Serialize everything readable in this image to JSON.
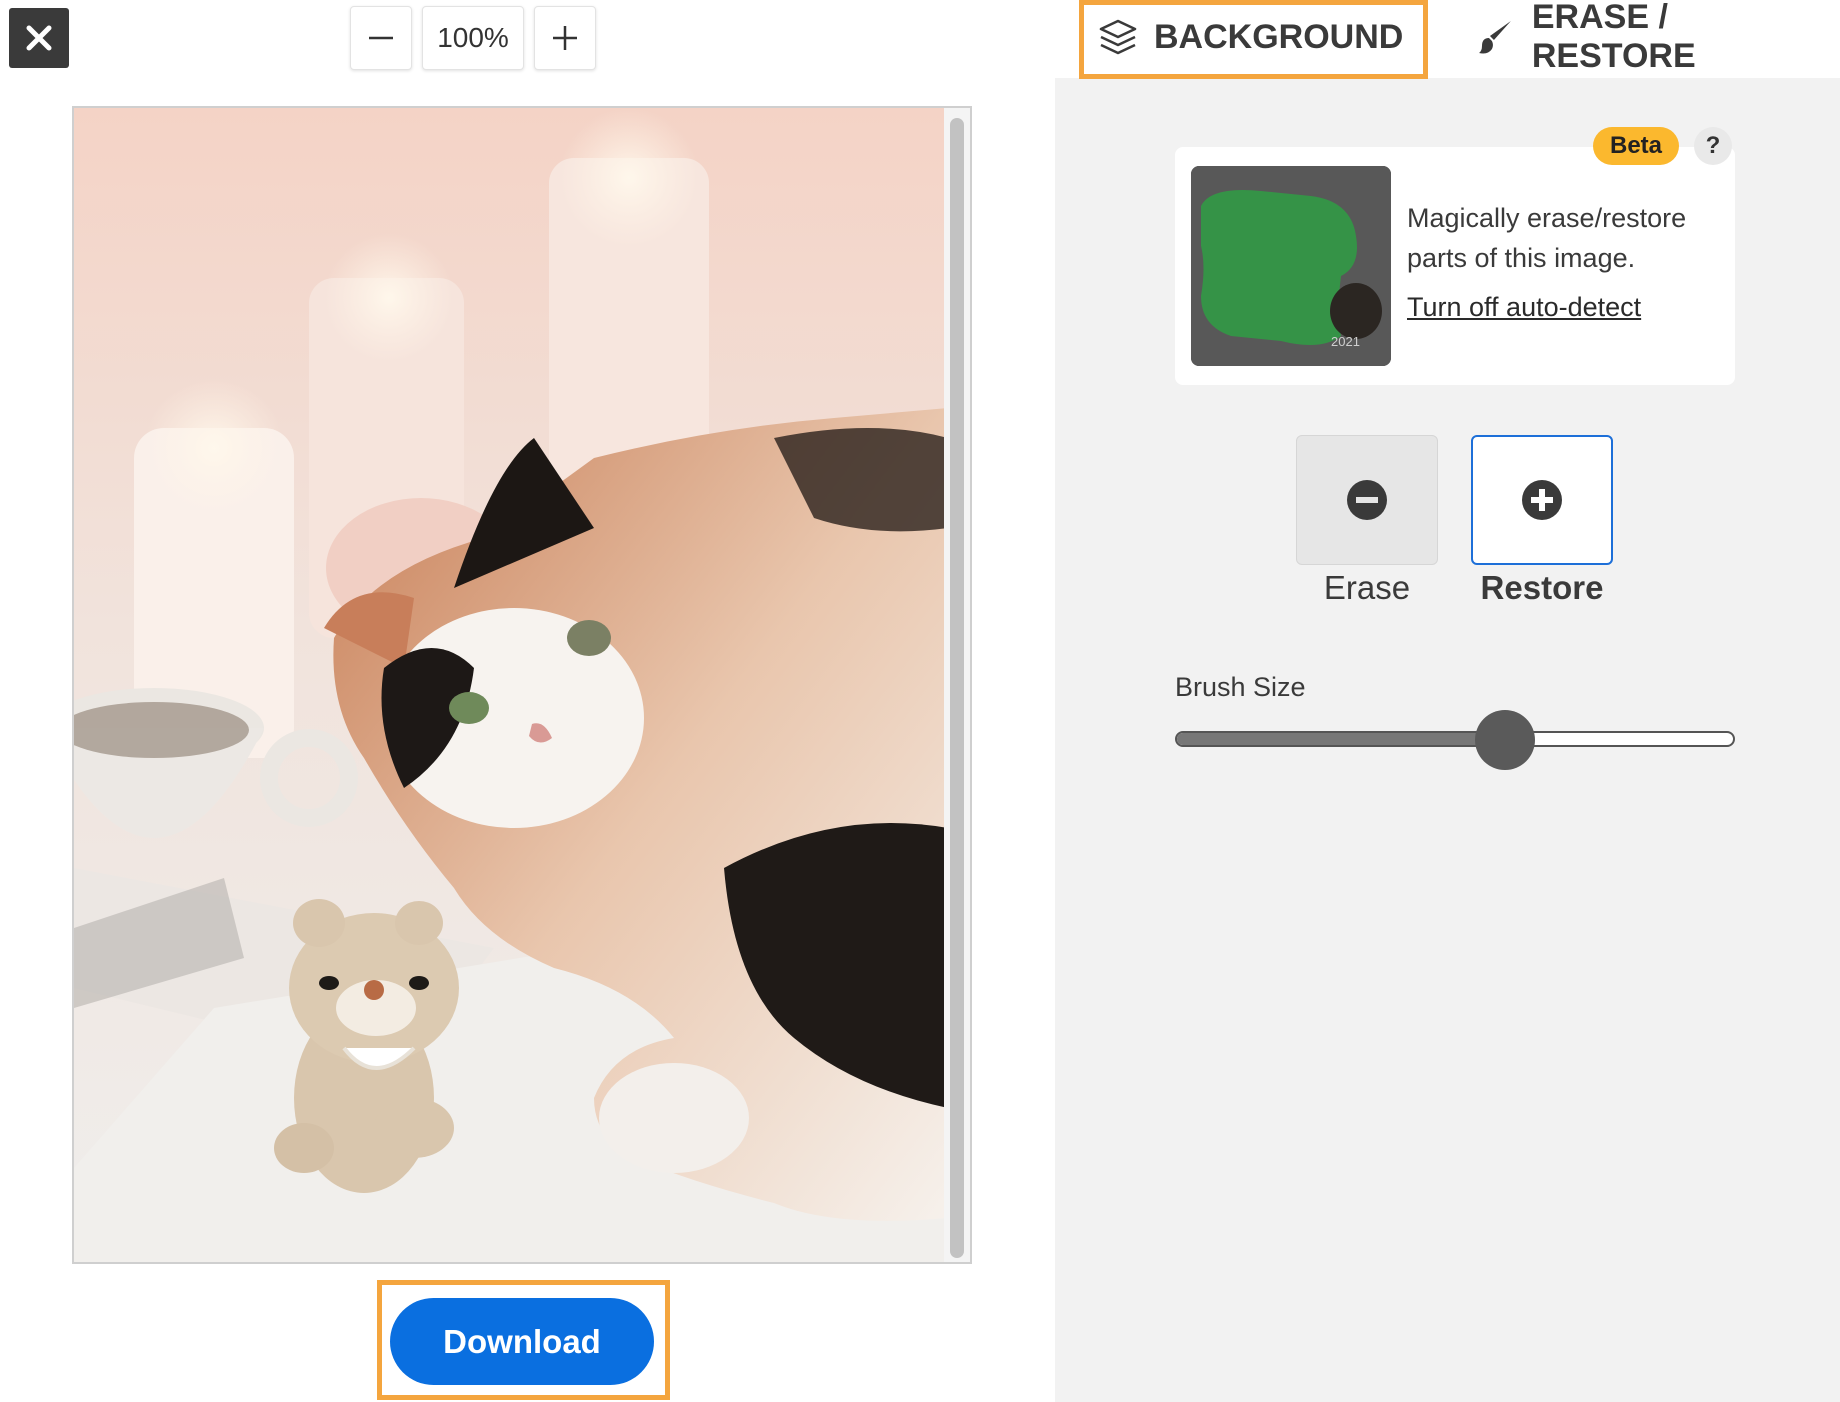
{
  "toolbar": {
    "close_icon": "close-icon",
    "zoom_out_icon": "minus-icon",
    "zoom_level": "100%",
    "zoom_in_icon": "plus-icon"
  },
  "canvas": {
    "image": "photo of a calico cat and a crocheted teddy bear with candles and a cup in the faded background"
  },
  "download": {
    "label": "Download"
  },
  "tabs": [
    {
      "label": "BACKGROUND",
      "icon": "layers-icon",
      "active": true
    },
    {
      "label": "ERASE / RESTORE",
      "icon": "brush-icon",
      "active": false
    }
  ],
  "info_card": {
    "badge": "Beta",
    "help": "?",
    "description": "Magically erase/restore parts of this image.",
    "link": "Turn off auto-detect"
  },
  "modes": {
    "erase": {
      "label": "Erase",
      "icon": "minus-circle-icon",
      "selected": false
    },
    "restore": {
      "label": "Restore",
      "icon": "plus-circle-icon",
      "selected": true
    }
  },
  "brush": {
    "label": "Brush Size",
    "value_fraction": 0.59
  },
  "colors": {
    "highlight": "#f4a53e",
    "primary": "#0a6fe0",
    "beta": "#fbb82e",
    "panel_bg": "#f2f2f2"
  }
}
